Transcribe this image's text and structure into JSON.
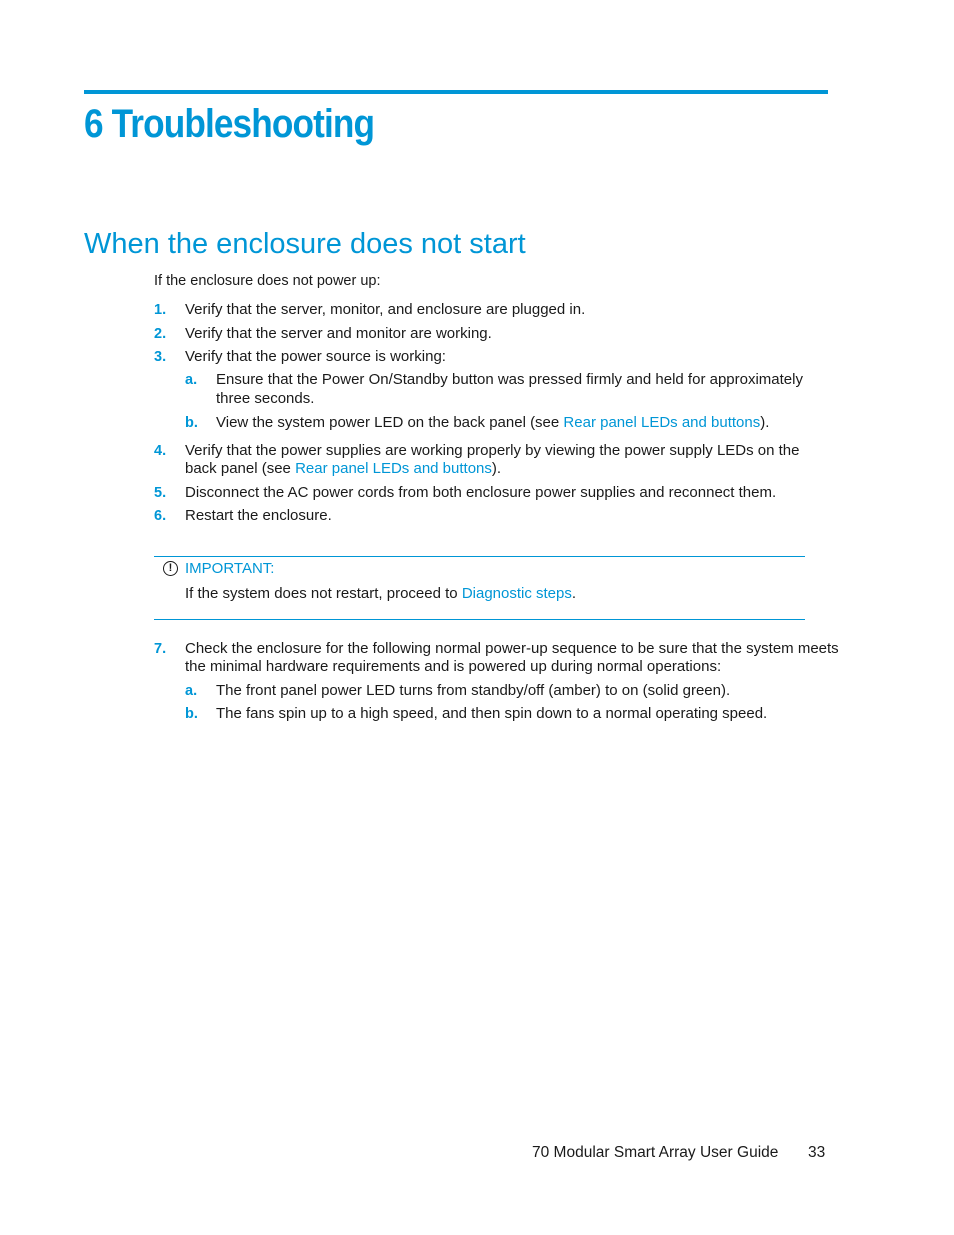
{
  "chapter": {
    "title": "6 Troubleshooting"
  },
  "section": {
    "title": "When the enclosure does not start"
  },
  "intro": "If the enclosure does not power up:",
  "steps": [
    {
      "num": "1.",
      "text": "Verify that the server, monitor, and enclosure are plugged in."
    },
    {
      "num": "2.",
      "text": "Verify that the server and monitor are working."
    },
    {
      "num": "3.",
      "text": "Verify that the power source is working:",
      "substeps": [
        {
          "num": "a.",
          "line1": "Ensure that the Power On/Standby button was pressed firmly and held for approximately",
          "line2": "three seconds."
        },
        {
          "num": "b.",
          "pre": "View the system power LED on the back panel (see ",
          "link": "Rear panel LEDs and buttons",
          "post": ")."
        }
      ]
    },
    {
      "num": "4.",
      "line1": "Verify that the power supplies are working properly by viewing the power supply LEDs on the",
      "pre": "back panel (see ",
      "link": "Rear panel LEDs and buttons",
      "post": ")."
    },
    {
      "num": "5.",
      "text": "Disconnect the AC power cords from both enclosure power supplies and reconnect them."
    },
    {
      "num": "6.",
      "text": "Restart the enclosure."
    },
    {
      "num": "7.",
      "line1": "Check the enclosure for the following normal power-up sequence to be sure that the system meets",
      "line2": "the minimal hardware requirements and is powered up during normal operations:",
      "substeps": [
        {
          "num": "a.",
          "text": "The front panel power LED turns from standby/off (amber) to on (solid green)."
        },
        {
          "num": "b.",
          "text": "The fans spin up to a high speed, and then spin down to a normal operating speed."
        }
      ]
    }
  ],
  "important": {
    "icon": "exclamation-circle-icon",
    "glyph": "!",
    "label": "IMPORTANT:",
    "pre": "If the system does not restart, proceed to ",
    "link": "Diagnostic steps",
    "post": "."
  },
  "footer": {
    "title": "70 Modular Smart Array User Guide",
    "page": "33"
  },
  "colors": {
    "accent": "#0096d6",
    "text": "#1a1a1a"
  }
}
